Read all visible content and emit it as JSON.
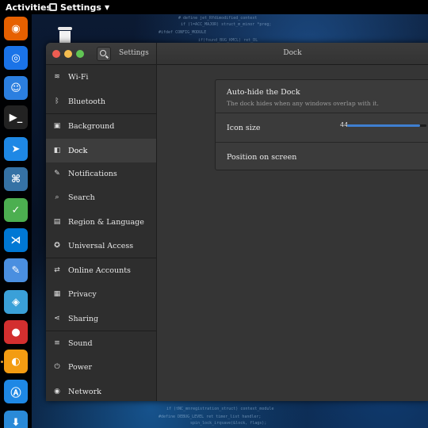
{
  "topbar": {
    "activities": "Activities",
    "app_name": "Settings"
  },
  "dock": {
    "items": [
      {
        "name": "firefox-icon",
        "color": "#e66000"
      },
      {
        "name": "chrome-icon",
        "color": "#1a73e8"
      },
      {
        "name": "finder-icon",
        "color": "#2b7fe0"
      },
      {
        "name": "terminal-icon",
        "color": "#222222"
      },
      {
        "name": "arrow-launcher-icon",
        "color": "#1e88e5"
      },
      {
        "name": "python-icon",
        "color": "#3572a5"
      },
      {
        "name": "gedit-icon",
        "color": "#4caf50"
      },
      {
        "name": "vscode-icon",
        "color": "#0078d4"
      },
      {
        "name": "notes-icon",
        "color": "#4a8fe0"
      },
      {
        "name": "network-icon",
        "color": "#3aa0d8"
      },
      {
        "name": "molecule-icon",
        "color": "#d32f2f"
      },
      {
        "name": "orange-icon",
        "color": "#f39c12"
      },
      {
        "name": "appstore-icon",
        "color": "#1e88e5"
      },
      {
        "name": "install-icon",
        "color": "#2a8ad8"
      }
    ]
  },
  "window": {
    "sidebar_title": "Settings",
    "title": "Dock"
  },
  "sidebar": {
    "items": [
      {
        "label": "Wi-Fi",
        "icon": "wifi-icon",
        "glyph": "≋"
      },
      {
        "label": "Bluetooth",
        "icon": "bluetooth-icon",
        "glyph": "ᛒ"
      },
      {
        "label": "Background",
        "icon": "background-icon",
        "glyph": "▣"
      },
      {
        "label": "Dock",
        "icon": "dock-icon",
        "glyph": "◧"
      },
      {
        "label": "Notifications",
        "icon": "notifications-icon",
        "glyph": "✎"
      },
      {
        "label": "Search",
        "icon": "search-icon",
        "glyph": "⌕"
      },
      {
        "label": "Region & Language",
        "icon": "region-icon",
        "glyph": "▤"
      },
      {
        "label": "Universal Access",
        "icon": "universal-access-icon",
        "glyph": "✪"
      },
      {
        "label": "Online Accounts",
        "icon": "online-accounts-icon",
        "glyph": "⇄"
      },
      {
        "label": "Privacy",
        "icon": "privacy-icon",
        "glyph": "▦"
      },
      {
        "label": "Sharing",
        "icon": "sharing-icon",
        "glyph": "⋖"
      },
      {
        "label": "Sound",
        "icon": "sound-icon",
        "glyph": "≡"
      },
      {
        "label": "Power",
        "icon": "power-icon",
        "glyph": "⏻"
      },
      {
        "label": "Network",
        "icon": "network-icon",
        "glyph": "◉"
      }
    ],
    "active": "Dock"
  },
  "dock_settings": {
    "autohide_title": "Auto-hide the Dock",
    "autohide_subtitle": "The dock hides when any windows overlap with it.",
    "icon_size_label": "Icon size",
    "icon_size_value": "44",
    "icon_size_fraction": 0.92,
    "position_label": "Position on screen"
  }
}
